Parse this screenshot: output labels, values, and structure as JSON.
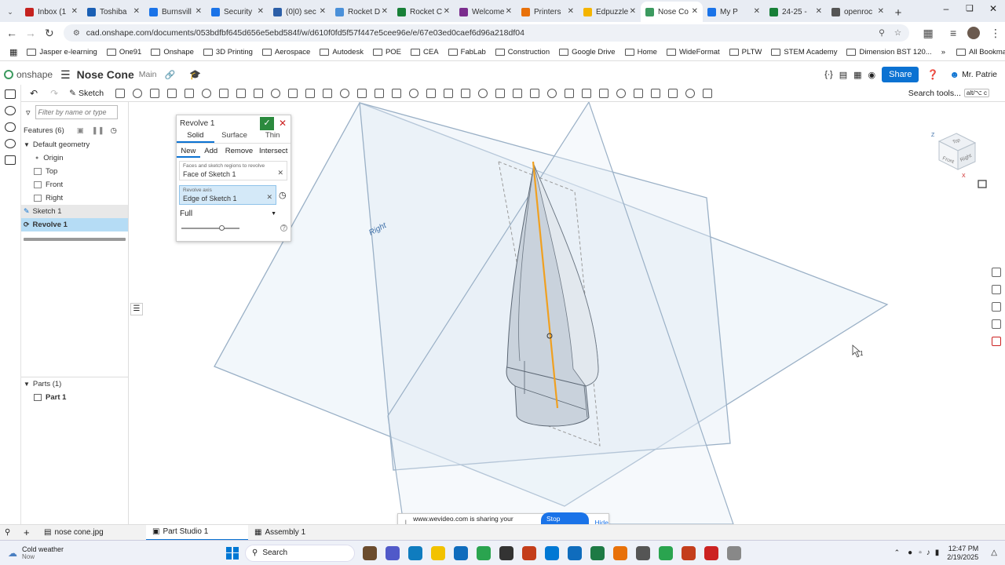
{
  "browser": {
    "tabs": [
      {
        "label": "Inbox (1",
        "color": "#c5221f"
      },
      {
        "label": "Toshiba",
        "color": "#1a5fb4"
      },
      {
        "label": "Burnsvill",
        "color": "#1a73e8"
      },
      {
        "label": "Security",
        "color": "#1a73e8"
      },
      {
        "label": "(0|0) sec",
        "color": "#2c5fa8"
      },
      {
        "label": "Rocket D",
        "color": "#4a90d9"
      },
      {
        "label": "Rocket C",
        "color": "#188038"
      },
      {
        "label": "Welcome",
        "color": "#7b2d8e"
      },
      {
        "label": "Printers",
        "color": "#e8710a"
      },
      {
        "label": "Edpuzzle",
        "color": "#f4b400"
      },
      {
        "label": "Nose Co",
        "color": "#3c9a5f",
        "active": true
      },
      {
        "label": "My P",
        "color": "#1a73e8"
      },
      {
        "label": "24-25 -",
        "color": "#188038"
      },
      {
        "label": "openroc",
        "color": "#555555"
      }
    ],
    "url": "cad.onshape.com/documents/053bdfbf645d656e5ebd584f/w/d610f0fd5f57f447e5cee96e/e/67e03ed0caef6d96a218df04",
    "bookmarks": [
      "Jasper e-learning",
      "One91",
      "Onshape",
      "3D Printing",
      "Aerospace",
      "Autodesk",
      "POE",
      "CEA",
      "FabLab",
      "Construction",
      "Google Drive",
      "Home",
      "WideFormat",
      "PLTW",
      "STEM Academy",
      "Dimension BST 120..."
    ],
    "all_bookmarks": "All Bookmarks"
  },
  "onshape": {
    "logo": "onshape",
    "doc_title": "Nose Cone",
    "branch": "Main",
    "share_label": "Share",
    "user": "Mr. Patrie",
    "search_tools": "Search tools...",
    "search_shortcut": "alt/⌥ c",
    "sketch_label": "Sketch",
    "accent": "#0b72d2"
  },
  "tree": {
    "filter_placeholder": "Filter by name or type",
    "features_label": "Features (6)",
    "default_geometry": "Default geometry",
    "items": [
      "Origin",
      "Top",
      "Front",
      "Right"
    ],
    "sketch": "Sketch 1",
    "revolve": "Revolve 1",
    "parts_label": "Parts (1)",
    "part": "Part 1"
  },
  "dialog": {
    "title": "Revolve 1",
    "types": [
      "Solid",
      "Surface",
      "Thin"
    ],
    "ops": [
      "New",
      "Add",
      "Remove",
      "Intersect"
    ],
    "faces_label": "Faces and sketch regions to revolve",
    "faces_value": "Face of Sketch 1",
    "axis_label": "Revolve axis",
    "axis_value": "Edge of Sketch 1",
    "extent": "Full"
  },
  "viewport": {
    "plane_label": "Right",
    "cube_faces": [
      "Top",
      "Front",
      "Right"
    ],
    "cube_axes": [
      "Z",
      "X"
    ],
    "cursor_badge": "1"
  },
  "share_banner": {
    "text": "www.wevideo.com is sharing your screen.",
    "stop": "Stop sharing",
    "hide": "Hide"
  },
  "bottom_tabs": [
    "nose cone.jpg",
    "Part Studio 1",
    "Assembly 1"
  ],
  "taskbar": {
    "weather_title": "Cold weather",
    "weather_sub": "Now",
    "search": "Search",
    "time": "12:47 PM",
    "date": "2/19/2025"
  }
}
